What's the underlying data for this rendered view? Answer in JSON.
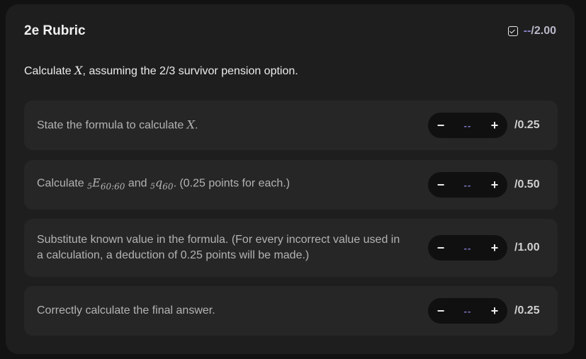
{
  "rubric": {
    "title": "2e Rubric",
    "score": "--",
    "max": "/2.00",
    "check_icon": "checkbox-icon"
  },
  "question": {
    "prefix": "Calculate ",
    "var": "X",
    "suffix": ", assuming the 2/3 survivor pension option."
  },
  "items": [
    {
      "text_prefix": "State the formula to calculate ",
      "var": "X",
      "text_suffix": ".",
      "value": "--",
      "minus": "−",
      "plus": "+",
      "max": "/0.25"
    },
    {
      "text_prefix": "Calculate ",
      "e_pre": "5",
      "e_var": "E",
      "e_sub": "60:60",
      "and": " and ",
      "q_pre": "5",
      "q_var": "q",
      "q_sub": "60",
      "text_suffix": ". (0.25 points for each.)",
      "value": "--",
      "minus": "−",
      "plus": "+",
      "max": "/0.50"
    },
    {
      "text": "Substitute known value in the formula. (For every incorrect value used in a calculation, a deduction of 0.25 points will be made.)",
      "value": "--",
      "minus": "−",
      "plus": "+",
      "max": "/1.00"
    },
    {
      "text": "Correctly calculate the final answer.",
      "value": "--",
      "minus": "−",
      "plus": "+",
      "max": "/0.25"
    }
  ]
}
